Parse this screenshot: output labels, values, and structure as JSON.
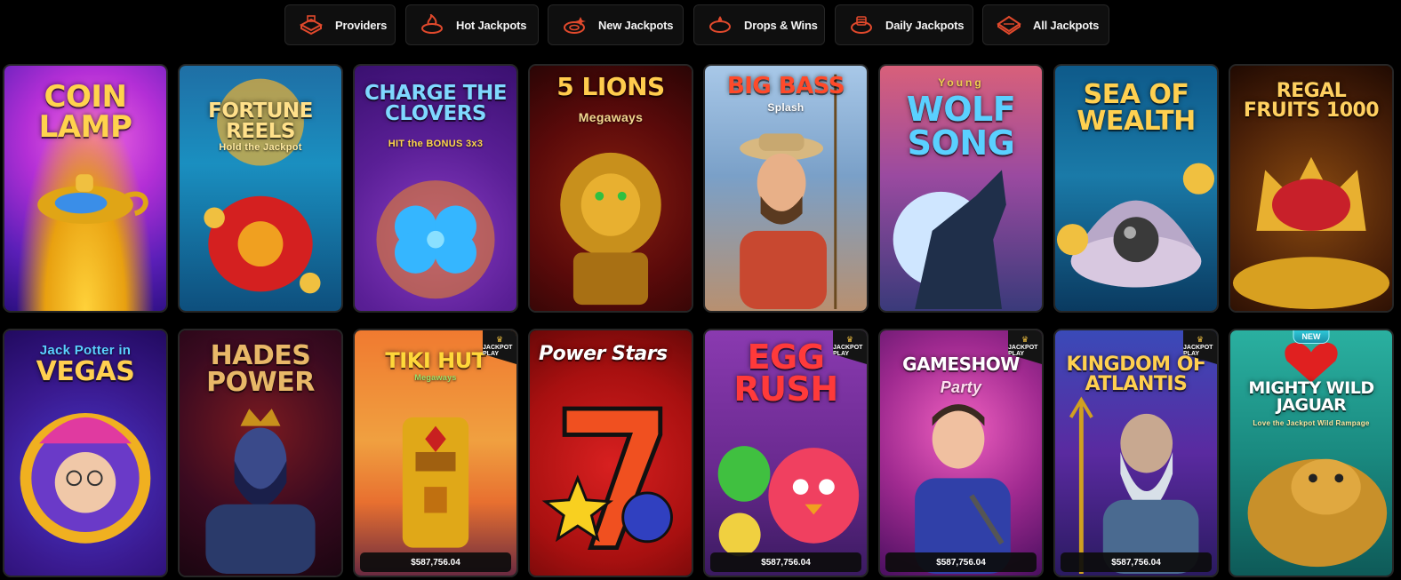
{
  "nav": {
    "tabs": [
      {
        "label": "Providers",
        "icon": "providers-icon"
      },
      {
        "label": "Hot Jackpots",
        "icon": "hot-jackpots-icon"
      },
      {
        "label": "New Jackpots",
        "icon": "new-jackpots-icon"
      },
      {
        "label": "Drops & Wins",
        "icon": "drops-wins-icon"
      },
      {
        "label": "Daily Jackpots",
        "icon": "daily-jackpots-icon"
      },
      {
        "label": "All Jackpots",
        "icon": "all-jackpots-icon"
      }
    ],
    "accent": "#e0492c"
  },
  "games": {
    "row1": [
      {
        "title": "Coin Lamp"
      },
      {
        "title": "Fortune Reels",
        "subtitle": "Hold the Jackpot"
      },
      {
        "title": "Charge the Clovers",
        "subtitle": "HIT the BONUS 3x3"
      },
      {
        "title": "5 Lions",
        "subtitle": "Megaways"
      },
      {
        "title": "Big Bass",
        "subtitle": "Splash"
      },
      {
        "title": "Wolf Song",
        "subtitle": "Young"
      },
      {
        "title": "Sea of Wealth"
      },
      {
        "title": "Regal Fruits 1000"
      }
    ],
    "row2": [
      {
        "title": "Vegas",
        "subtitle": "Jack Potter in"
      },
      {
        "title": "Hades Power"
      },
      {
        "title": "Tiki Hut",
        "subtitle": "Megaways",
        "jackpot": "$587,756.04",
        "badge": "JACKPOT PLAY"
      },
      {
        "title": "Power Stars"
      },
      {
        "title": "Egg Rush",
        "jackpot": "$587,756.04",
        "badge": "JACKPOT PLAY"
      },
      {
        "title": "Gameshow",
        "subtitle": "Party",
        "jackpot": "$587,756.04",
        "badge": "JACKPOT PLAY"
      },
      {
        "title": "Kingdom of Atlantis",
        "jackpot": "$587,756.04",
        "badge": "JACKPOT PLAY"
      },
      {
        "title": "Mighty Wild Jaguar",
        "subtitle": "Love the Jackpot Wild Rampage",
        "badge_new": "NEW"
      }
    ]
  }
}
